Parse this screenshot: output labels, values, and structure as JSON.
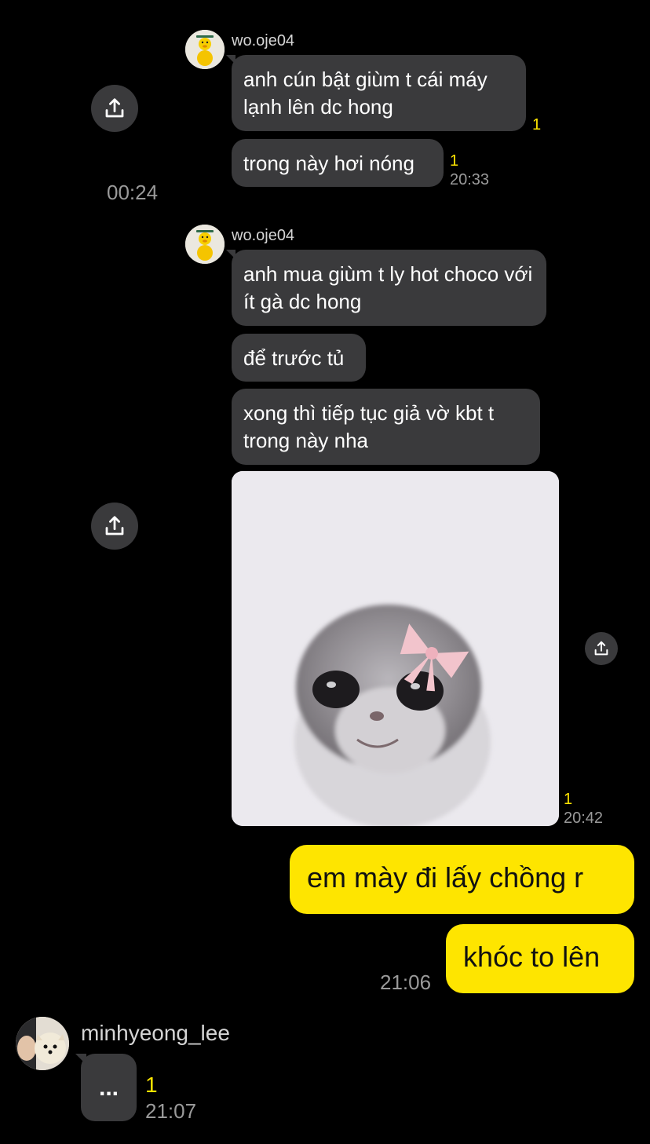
{
  "messages": {
    "group1": {
      "sender": "wo.oje04",
      "bubble1": "anh cún bật giùm t cái máy lạnh lên dc hong",
      "bubble1_unread": "1",
      "bubble2": "trong này hơi nóng",
      "bubble2_unread": "1",
      "bubble2_time": "20:33"
    },
    "forwarded_time": "00:24",
    "group2": {
      "sender": "wo.oje04",
      "bubble1": "anh mua giùm t ly hot choco với ít gà dc hong",
      "bubble2": "để trước tủ",
      "bubble3": "xong thì tiếp tục giả vờ kbt t trong này nha",
      "photo_unread": "1",
      "photo_time": "20:42"
    },
    "mine": {
      "bubble1": "em mày đi lấy chồng r",
      "bubble2": "khóc to lên",
      "time": "21:06"
    },
    "group3": {
      "sender": "minhyeong_lee",
      "typing": "...",
      "unread": "1",
      "time": "21:07"
    }
  },
  "icons": {
    "share": "share-upload-icon",
    "avatar1": "yellow-duck-avatar",
    "avatar2": "pomeranian-avatar",
    "photo": "hamster-with-pink-bow-photo"
  },
  "colors": {
    "background": "#000000",
    "incoming_bubble": "#3a3a3c",
    "outgoing_bubble": "#fee500",
    "unread": "#fee500",
    "time": "#9a9a9a"
  }
}
